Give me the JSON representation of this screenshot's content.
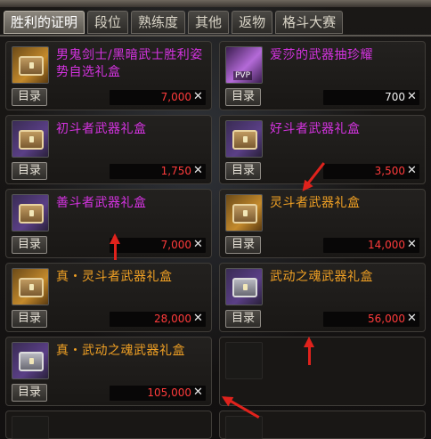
{
  "tabs": [
    {
      "label": "胜利的证明",
      "active": true
    },
    {
      "label": "段位",
      "active": false
    },
    {
      "label": "熟练度",
      "active": false
    },
    {
      "label": "其他",
      "active": false
    },
    {
      "label": "返物",
      "active": false
    },
    {
      "label": "格斗大赛",
      "active": false
    }
  ],
  "items": [
    {
      "name": "男鬼剑士/黑暗武士胜利姿势自选礼盒",
      "name_color": "magenta",
      "icon": "gold-chest-icon",
      "dir_label": "目录",
      "price": "7,000",
      "price_color": "red"
    },
    {
      "name": "爱莎的武器抽珍耀",
      "name_color": "magenta",
      "icon": "pvp-crystal-icon",
      "icon_badge": "PVP",
      "dir_label": "目录",
      "price": "700",
      "price_color": "white"
    },
    {
      "name": "初斗者武器礼盒",
      "name_color": "magenta",
      "icon": "purple-chest-icon",
      "dir_label": "目录",
      "price": "1,750",
      "price_color": "red"
    },
    {
      "name": "好斗者武器礼盒",
      "name_color": "magenta",
      "icon": "purple-chest-icon",
      "dir_label": "目录",
      "price": "3,500",
      "price_color": "red"
    },
    {
      "name": "善斗者武器礼盒",
      "name_color": "magenta",
      "icon": "purple-chest-icon",
      "dir_label": "目录",
      "price": "7,000",
      "price_color": "red"
    },
    {
      "name": "灵斗者武器礼盒",
      "name_color": "orange",
      "icon": "gold-chest-icon",
      "dir_label": "目录",
      "price": "14,000",
      "price_color": "red"
    },
    {
      "name": "真・灵斗者武器礼盒",
      "name_color": "orange",
      "icon": "gold-chest-icon",
      "dir_label": "目录",
      "price": "28,000",
      "price_color": "red"
    },
    {
      "name": "武动之魂武器礼盒",
      "name_color": "orange",
      "icon": "silver-chest-icon",
      "dir_label": "目录",
      "price": "56,000",
      "price_color": "red"
    },
    {
      "name": "真・武动之魂武器礼盒",
      "name_color": "orange",
      "icon": "silver-chest-icon",
      "dir_label": "目录",
      "price": "105,000",
      "price_color": "red"
    }
  ],
  "colors": {
    "magenta": "#d433e0",
    "orange": "#f0a024",
    "red_price": "#ff3b3b",
    "arrow": "#e0221c"
  }
}
